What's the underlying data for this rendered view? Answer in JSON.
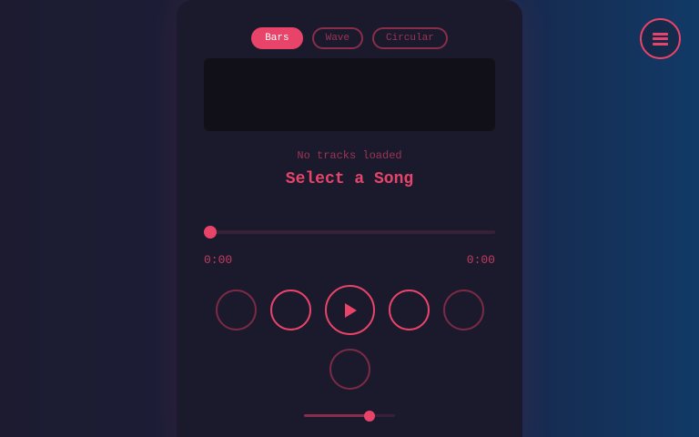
{
  "accent_color": "#e8446a",
  "visualizer_tabs": [
    {
      "label": "Bars",
      "active": true
    },
    {
      "label": "Wave",
      "active": false
    },
    {
      "label": "Circular",
      "active": false
    }
  ],
  "player": {
    "status": "No tracks loaded",
    "track_title": "Select a Song",
    "current_time": "0:00",
    "duration": "0:00",
    "progress": 0,
    "volume": 0.72
  },
  "controls": {
    "shuffle_glyph": "",
    "prev_glyph": "",
    "next_glyph": "",
    "repeat_glyph": "",
    "playlist_glyph": "",
    "volume_low_glyph": "",
    "volume_high_glyph": ""
  },
  "icons": {
    "menu": "menu-icon",
    "play": "play-icon"
  }
}
